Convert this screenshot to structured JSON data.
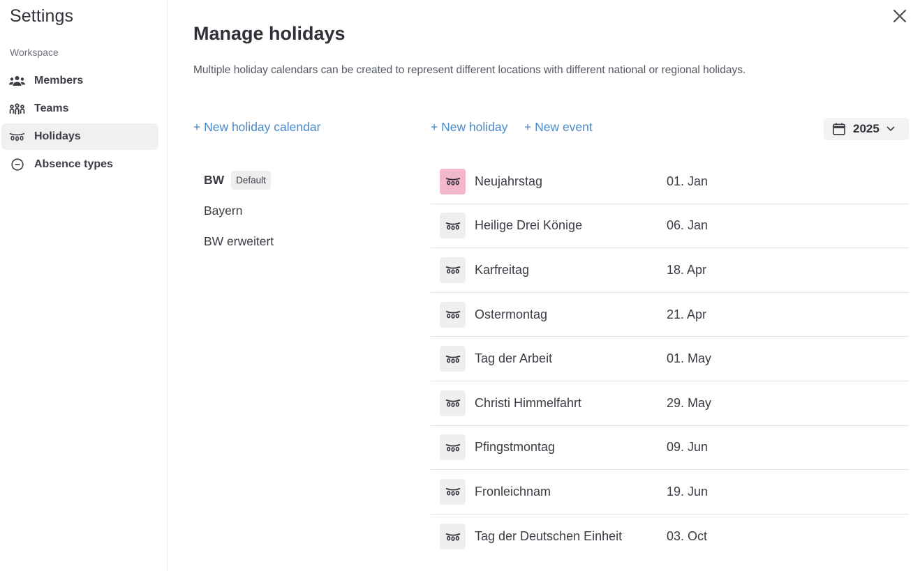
{
  "sidebar": {
    "title": "Settings",
    "section": "Workspace",
    "items": [
      {
        "label": "Members",
        "icon": "members-icon"
      },
      {
        "label": "Teams",
        "icon": "teams-icon"
      },
      {
        "label": "Holidays",
        "icon": "holiday-garland-icon",
        "active": true
      },
      {
        "label": "Absence types",
        "icon": "minus-circle-icon"
      }
    ]
  },
  "main": {
    "title": "Manage holidays",
    "description": "Multiple holiday calendars can be created to represent different locations with different national or regional holidays.",
    "new_calendar_label": "+ New holiday calendar",
    "new_holiday_label": "+ New holiday",
    "new_event_label": "+ New event",
    "year": "2025"
  },
  "calendars": [
    {
      "name": "BW",
      "badge": "Default",
      "selected": true
    },
    {
      "name": "Bayern"
    },
    {
      "name": "BW erweitert"
    }
  ],
  "holidays": [
    {
      "name": "Neujahrstag",
      "date": "01. Jan",
      "highlight": true
    },
    {
      "name": "Heilige Drei Könige",
      "date": "06. Jan"
    },
    {
      "name": "Karfreitag",
      "date": "18. Apr"
    },
    {
      "name": "Ostermontag",
      "date": "21. Apr"
    },
    {
      "name": "Tag der Arbeit",
      "date": "01. May"
    },
    {
      "name": "Christi Himmelfahrt",
      "date": "29. May"
    },
    {
      "name": "Pfingstmontag",
      "date": "09. Jun"
    },
    {
      "name": "Fronleichnam",
      "date": "19. Jun"
    },
    {
      "name": "Tag der Deutschen Einheit",
      "date": "03. Oct"
    }
  ],
  "colors": {
    "accent_link": "#4a88c7",
    "highlight_icon_bg": "#f3b8cb",
    "active_nav_bg": "#f0f0f1"
  }
}
